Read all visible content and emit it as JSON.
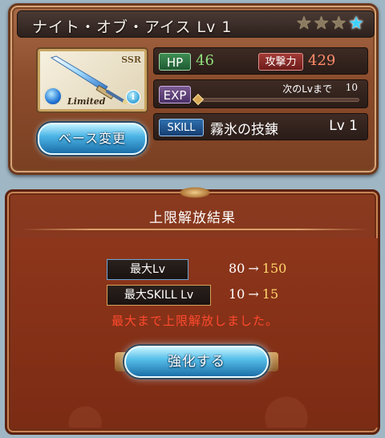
{
  "weapon": {
    "title": "ナイト・オブ・アイス Lv 1",
    "stars_total": 4,
    "stars_filled": 1,
    "rarity_badge": "SSR",
    "limited_label": "Limited",
    "info_glyph": "i",
    "element_icon": "water-element-icon",
    "change_base_label": "ベース変更"
  },
  "stats": {
    "hp_label": "HP",
    "hp_value": "46",
    "atk_label": "攻撃力",
    "atk_value": "429",
    "exp_label": "EXP",
    "exp_next_label": "次のLvまで",
    "exp_next_value": "10",
    "exp_progress": 0.0,
    "skill_label": "SKILL",
    "skill_name": "霧氷の技錬",
    "skill_level": "Lv 1"
  },
  "result": {
    "panel_title": "上限解放結果",
    "max_lv_label": "最大Lv",
    "max_lv_old": "80",
    "max_lv_new": "150",
    "max_skill_label": "最大SKILL Lv",
    "max_skill_old": "10",
    "max_skill_new": "15",
    "arrow": "→",
    "max_message": "最大まで上限解放しました。",
    "enhance_label": "強化する"
  },
  "colors": {
    "frame_brown": "#8b4c2c",
    "panel_red": "#7a2e18",
    "button_blue": "#4db6e6",
    "hp_green": "#8fe07a",
    "atk_red": "#ff8b6a",
    "new_value_gold": "#ffd56b",
    "message_red": "#ff4a2e"
  }
}
